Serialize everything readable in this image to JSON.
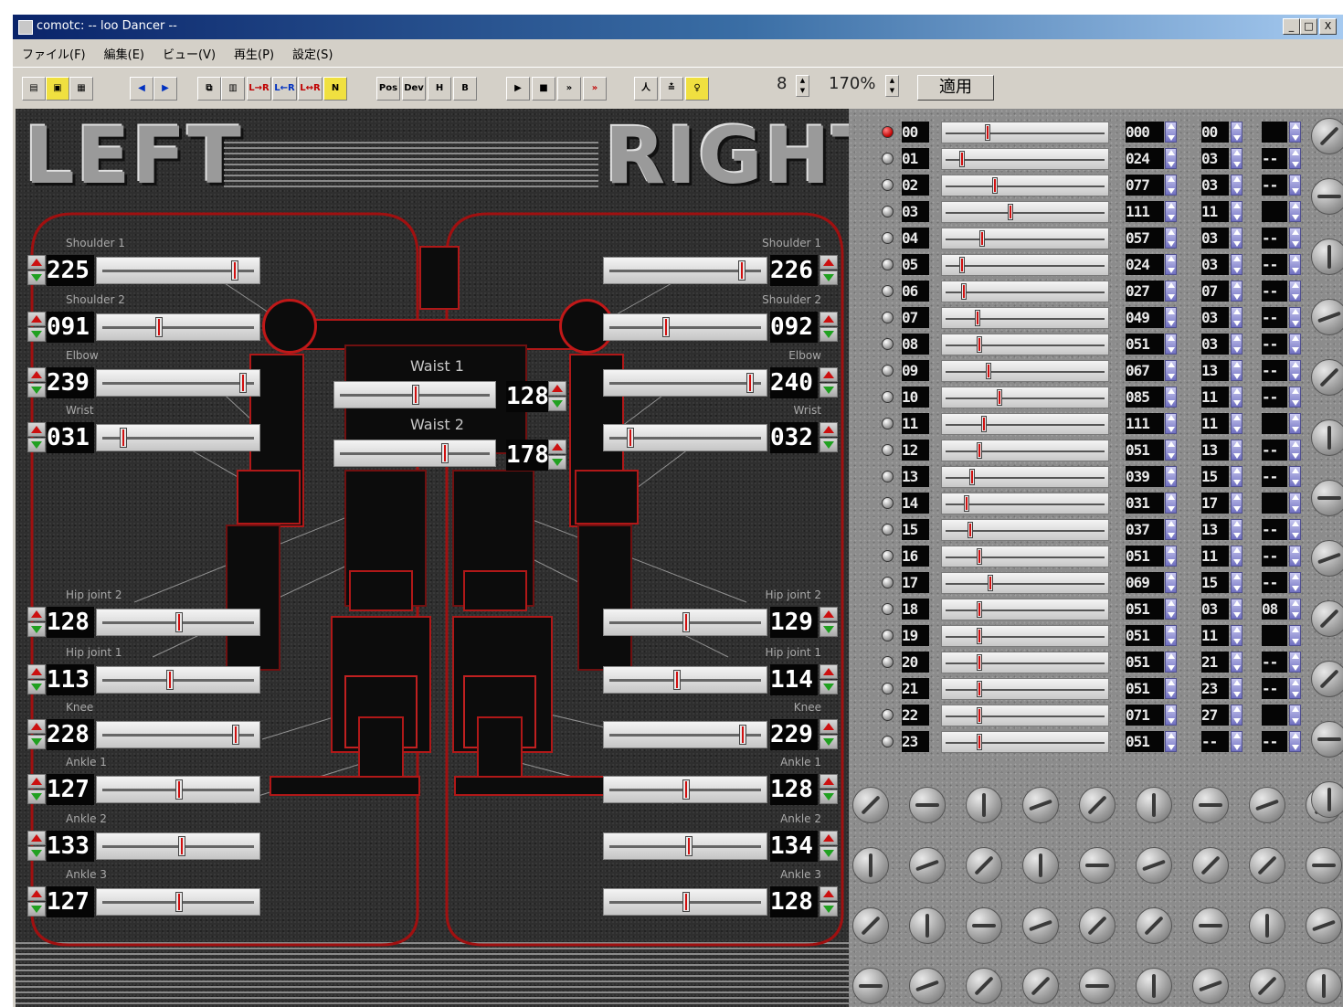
{
  "window": {
    "title": "comotc: -- loo Dancer --",
    "min_label": "_",
    "max_label": "□",
    "close_label": "X"
  },
  "menu": [
    "ファイル(F)",
    "編集(E)",
    "ビュー(V)",
    "再生(P)",
    "設定(S)"
  ],
  "toolbar": {
    "buttons": [
      {
        "name": "new",
        "glyph": "▤"
      },
      {
        "name": "open",
        "glyph": "▣"
      },
      {
        "name": "save",
        "glyph": "▦"
      },
      {
        "name": "back",
        "glyph": "◀"
      },
      {
        "name": "forward",
        "glyph": "▶"
      },
      {
        "name": "copy",
        "glyph": "⧉"
      },
      {
        "name": "paste",
        "glyph": "▥"
      },
      {
        "name": "mirror-l-r",
        "glyph": "L→R"
      },
      {
        "name": "mirror-r-l",
        "glyph": "L←R"
      },
      {
        "name": "mirror-swap",
        "glyph": "L↔R"
      },
      {
        "name": "flag",
        "glyph": "N"
      },
      {
        "name": "pos",
        "glyph": "Pos"
      },
      {
        "name": "dev",
        "glyph": "Dev"
      },
      {
        "name": "h",
        "glyph": "H"
      },
      {
        "name": "b",
        "glyph": "B"
      },
      {
        "name": "play",
        "glyph": "▶"
      },
      {
        "name": "stop",
        "glyph": "■"
      },
      {
        "name": "fast-forward",
        "glyph": "»"
      },
      {
        "name": "record-forward",
        "glyph": "»"
      },
      {
        "name": "figure",
        "glyph": "人"
      },
      {
        "name": "align",
        "glyph": "≛"
      },
      {
        "name": "light",
        "glyph": "♀"
      }
    ],
    "step_value": "8",
    "zoom_value": "170%",
    "apply_label": "適用"
  },
  "stage": {
    "left_title": "LEFT",
    "right_title": "RIGHT",
    "waist": [
      {
        "label": "Waist 1",
        "value": "128",
        "pos": 0.5
      },
      {
        "label": "Waist 2",
        "value": "178",
        "pos": 0.7
      }
    ],
    "left_joints": [
      {
        "label": "Shoulder 1",
        "value": "225",
        "pos": 0.88
      },
      {
        "label": "Shoulder 2",
        "value": "091",
        "pos": 0.36
      },
      {
        "label": "Elbow",
        "value": "239",
        "pos": 0.94
      },
      {
        "label": "Wrist",
        "value": "031",
        "pos": 0.12
      },
      {
        "label": "Hip joint 2",
        "value": "128",
        "pos": 0.5
      },
      {
        "label": "Hip joint 1",
        "value": "113",
        "pos": 0.44
      },
      {
        "label": "Knee",
        "value": "228",
        "pos": 0.89
      },
      {
        "label": "Ankle 1",
        "value": "127",
        "pos": 0.5
      },
      {
        "label": "Ankle 2",
        "value": "133",
        "pos": 0.52
      },
      {
        "label": "Ankle 3",
        "value": "127",
        "pos": 0.5
      }
    ],
    "right_joints": [
      {
        "label": "Shoulder 1",
        "value": "226",
        "pos": 0.88
      },
      {
        "label": "Shoulder 2",
        "value": "092",
        "pos": 0.36
      },
      {
        "label": "Elbow",
        "value": "240",
        "pos": 0.94
      },
      {
        "label": "Wrist",
        "value": "032",
        "pos": 0.12
      },
      {
        "label": "Hip joint 2",
        "value": "129",
        "pos": 0.5
      },
      {
        "label": "Hip joint 1",
        "value": "114",
        "pos": 0.44
      },
      {
        "label": "Knee",
        "value": "229",
        "pos": 0.89
      },
      {
        "label": "Ankle 1",
        "value": "128",
        "pos": 0.5
      },
      {
        "label": "Ankle 2",
        "value": "134",
        "pos": 0.52
      },
      {
        "label": "Ankle 3",
        "value": "128",
        "pos": 0.5
      }
    ]
  },
  "channels": [
    {
      "id": "00",
      "value": "000",
      "b": "00",
      "c": "",
      "pos": 0.25,
      "active": true
    },
    {
      "id": "01",
      "value": "024",
      "b": "03",
      "c": "--",
      "pos": 0.09,
      "active": false
    },
    {
      "id": "02",
      "value": "077",
      "b": "03",
      "c": "--",
      "pos": 0.3,
      "active": false
    },
    {
      "id": "03",
      "value": "111",
      "b": "11",
      "c": "",
      "pos": 0.4,
      "active": false
    },
    {
      "id": "04",
      "value": "057",
      "b": "03",
      "c": "--",
      "pos": 0.22,
      "active": false
    },
    {
      "id": "05",
      "value": "024",
      "b": "03",
      "c": "--",
      "pos": 0.09,
      "active": false
    },
    {
      "id": "06",
      "value": "027",
      "b": "07",
      "c": "--",
      "pos": 0.1,
      "active": false
    },
    {
      "id": "07",
      "value": "049",
      "b": "03",
      "c": "--",
      "pos": 0.19,
      "active": false
    },
    {
      "id": "08",
      "value": "051",
      "b": "03",
      "c": "--",
      "pos": 0.2,
      "active": false
    },
    {
      "id": "09",
      "value": "067",
      "b": "13",
      "c": "--",
      "pos": 0.26,
      "active": false
    },
    {
      "id": "10",
      "value": "085",
      "b": "11",
      "c": "--",
      "pos": 0.33,
      "active": false
    },
    {
      "id": "11",
      "value": "111",
      "b": "11",
      "c": "",
      "pos": 0.23,
      "active": false
    },
    {
      "id": "12",
      "value": "051",
      "b": "13",
      "c": "--",
      "pos": 0.2,
      "active": false
    },
    {
      "id": "13",
      "value": "039",
      "b": "15",
      "c": "--",
      "pos": 0.15,
      "active": false
    },
    {
      "id": "14",
      "value": "031",
      "b": "17",
      "c": "",
      "pos": 0.12,
      "active": false
    },
    {
      "id": "15",
      "value": "037",
      "b": "13",
      "c": "--",
      "pos": 0.14,
      "active": false
    },
    {
      "id": "16",
      "value": "051",
      "b": "11",
      "c": "--",
      "pos": 0.2,
      "active": false
    },
    {
      "id": "17",
      "value": "069",
      "b": "15",
      "c": "--",
      "pos": 0.27,
      "active": false
    },
    {
      "id": "18",
      "value": "051",
      "b": "03",
      "c": "08",
      "pos": 0.2,
      "active": false
    },
    {
      "id": "19",
      "value": "051",
      "b": "11",
      "c": "",
      "pos": 0.2,
      "active": false
    },
    {
      "id": "20",
      "value": "051",
      "b": "21",
      "c": "--",
      "pos": 0.2,
      "active": false
    },
    {
      "id": "21",
      "value": "051",
      "b": "23",
      "c": "--",
      "pos": 0.2,
      "active": false
    },
    {
      "id": "22",
      "value": "071",
      "b": "27",
      "c": "",
      "pos": 0.2,
      "active": false
    },
    {
      "id": "23",
      "value": "051",
      "b": "--",
      "c": "--",
      "pos": 0.2,
      "active": false
    }
  ]
}
